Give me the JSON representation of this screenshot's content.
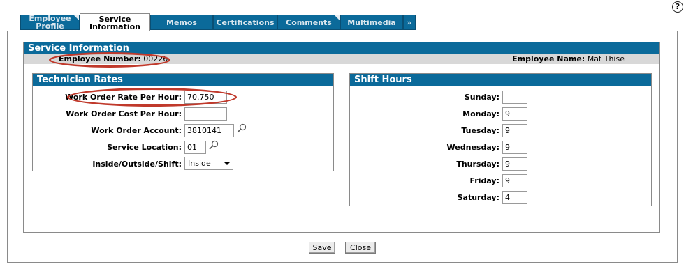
{
  "help_icon": "?",
  "tabs": [
    {
      "label": "Employee\nProfile"
    },
    {
      "label": "Service\nInformation"
    },
    {
      "label": "Memos"
    },
    {
      "label": "Certifications"
    },
    {
      "label": "Comments"
    },
    {
      "label": "Multimedia"
    },
    {
      "label": "»"
    }
  ],
  "section": {
    "title": "Service Information",
    "employee_number_label": "Employee Number:",
    "employee_number": "00226",
    "employee_name_label": "Employee Name:",
    "employee_name": "Mat Thise"
  },
  "tech_rates": {
    "title": "Technician Rates",
    "fields": [
      {
        "label": "Work Order Rate Per Hour:",
        "value": "70.750"
      },
      {
        "label": "Work Order Cost Per Hour:",
        "value": ""
      },
      {
        "label": "Work Order Account:",
        "value": "3810141"
      },
      {
        "label": "Service Location:",
        "value": "01"
      },
      {
        "label": "Inside/Outside/Shift:",
        "value": "Inside"
      }
    ]
  },
  "shift_hours": {
    "title": "Shift Hours",
    "days": [
      {
        "label": "Sunday:",
        "value": ""
      },
      {
        "label": "Monday:",
        "value": "9"
      },
      {
        "label": "Tuesday:",
        "value": "9"
      },
      {
        "label": "Wednesday:",
        "value": "9"
      },
      {
        "label": "Thursday:",
        "value": "9"
      },
      {
        "label": "Friday:",
        "value": "9"
      },
      {
        "label": "Saturday:",
        "value": "4"
      }
    ]
  },
  "buttons": {
    "save": "Save",
    "close": "Close"
  },
  "colors": {
    "accent": "#0b6a9a",
    "highlight_oval": "#c0392b",
    "grey_bar": "#d8d8d8"
  }
}
